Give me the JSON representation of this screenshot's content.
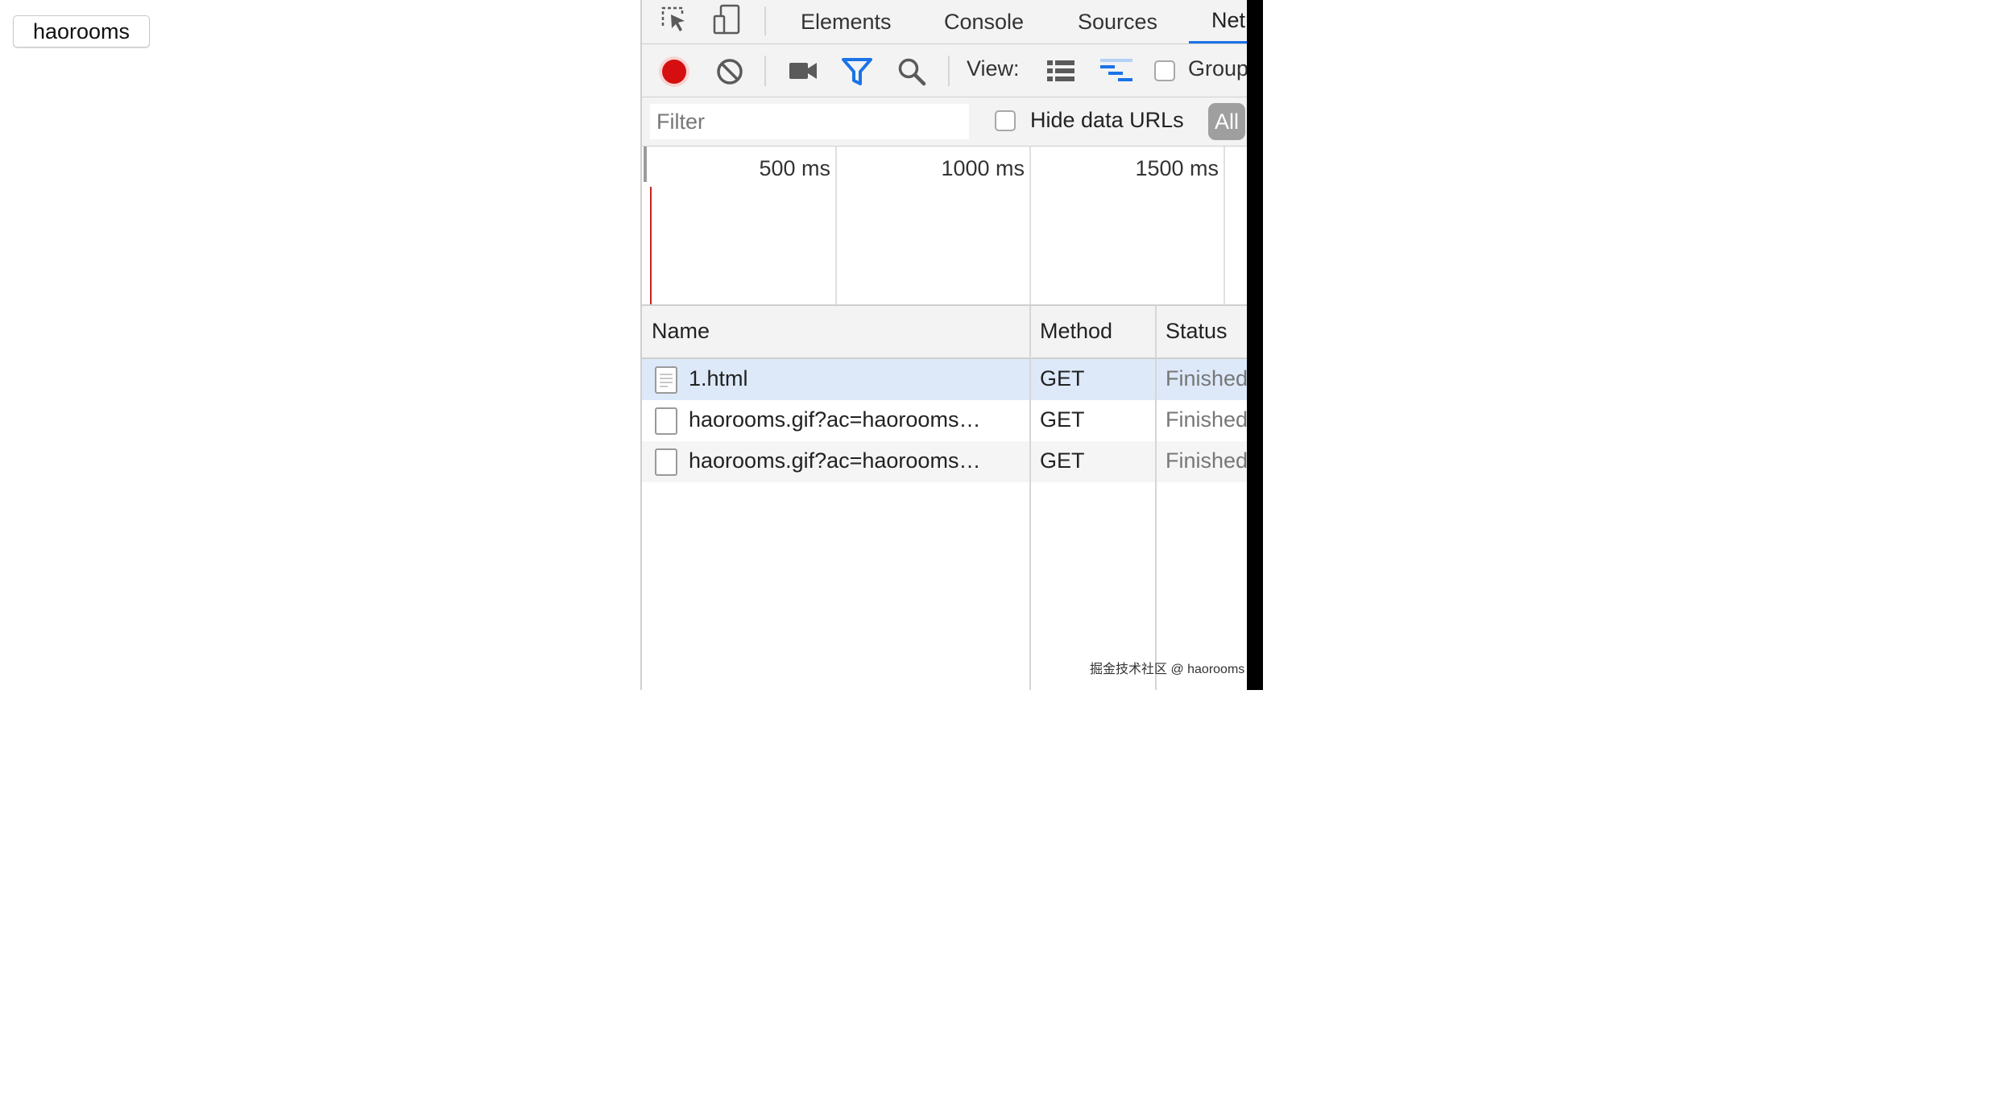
{
  "page": {
    "button_label": "haorooms"
  },
  "devtools": {
    "tabs": [
      "Elements",
      "Console",
      "Sources",
      "Net"
    ],
    "toolbar": {
      "view_label": "View:",
      "group_label": "Group"
    },
    "filter": {
      "placeholder": "Filter",
      "hide_data_urls_label": "Hide data URLs",
      "all_label": "All"
    },
    "overview": {
      "ticks": [
        "500 ms",
        "1000 ms",
        "1500 ms"
      ]
    },
    "table": {
      "columns": [
        "Name",
        "Method",
        "Status"
      ],
      "rows": [
        {
          "name": "1.html",
          "method": "GET",
          "status": "Finished"
        },
        {
          "name": "haorooms.gif?ac=haorooms…",
          "method": "GET",
          "status": "Finished"
        },
        {
          "name": "haorooms.gif?ac=haorooms…",
          "method": "GET",
          "status": "Finished"
        }
      ]
    },
    "icons": [
      "select-element-icon",
      "device-toolbar-icon",
      "record-icon",
      "clear-icon",
      "screenshot-icon",
      "filter-icon",
      "search-icon",
      "large-rows-icon",
      "waterfall-icon",
      "document-icon"
    ],
    "colors": {
      "record": "#d50f0f",
      "accent": "#1a73e8",
      "selected_row": "#dde9f9"
    }
  },
  "watermark": "掘金技术社区 @ haorooms"
}
